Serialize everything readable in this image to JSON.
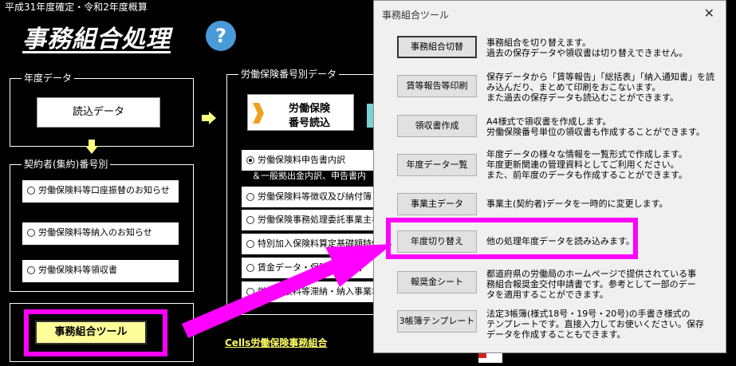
{
  "header": {
    "caption": "平成31年度確定・令和2年度概算",
    "title": "事務組合処理",
    "help_symbol": "?"
  },
  "year_data": {
    "label": "年度データ",
    "load_button": "読込データ"
  },
  "contractor": {
    "label": "契約者(集約)番号別",
    "options": [
      "労働保険料等口座振替のお知らせ",
      "労働保険料等納入のお知らせ",
      "労働保険料等領収書"
    ]
  },
  "labor_insurance": {
    "label": "労働保険番号別データ",
    "read_button_line1": "労働保険",
    "read_button_line2": "番号読込",
    "options": [
      "労働保険料申告書内訳",
      "＆一般拠出金内訳、申告書内",
      "労働保険料等徴収及び納付簿",
      "労働保険事務処理委託事業主名",
      "特別加入保険料算定基礎額特例",
      "賃金データ・保険料一括有",
      "労働保険料等滞納・納入事業場"
    ]
  },
  "tool_button": "事務組合ツール",
  "footer_link": "Cells労働保険事務組合",
  "dialog": {
    "title": "事務組合ツール",
    "close": "✕",
    "rows": [
      {
        "button": "事務組合切替",
        "desc": [
          "事務組合を切り替えます。",
          "過去の保存データや領収書は切り替えできません。"
        ]
      },
      {
        "button": "賃等報告等印刷",
        "desc": [
          "保存データから「賃等報告」「総括表」「納入通知書」を読",
          "み込んだり、まとめて印刷をおこないます。",
          "また過去の保存データも読込むことができます。"
        ]
      },
      {
        "button": "領収書作成",
        "desc": [
          "A4様式で領収書を作成します。",
          "労働保険番号単位の領収書も作成することができます。"
        ]
      },
      {
        "button": "年度データ一覧",
        "desc": [
          "年度データの様々な情報を一覧形式で作成します。",
          "年度更新関連の管理資料としてご利用ください。",
          "また、前年度のデータも作成することができます。"
        ]
      },
      {
        "button": "事業主データ",
        "desc": [
          "事業主(契約者)データを一時的に変更します。"
        ]
      },
      {
        "button": "年度切り替え",
        "desc": [
          "他の処理年度データを読み込みます。"
        ]
      },
      {
        "button": "報奨金シート",
        "desc": [
          "都道府県の労働局のホームページで提供されている事",
          "務組合報奨金交付申請書です。参考として一部のデー",
          "タを適用することができます。"
        ]
      },
      {
        "button": "3帳簿テンプレート",
        "desc": [
          "法定3帳簿(様式18号・19号・20号)の手書き様式の",
          "テンプレートです。直接入力してお使いください。保存",
          "データを作成することもできます。"
        ]
      }
    ]
  },
  "colors": {
    "highlight": "#ff00ff",
    "tool_button_bg": "#ffff99",
    "help_button": "#4a9ad8",
    "arrow_yellow": "#ffff80"
  }
}
